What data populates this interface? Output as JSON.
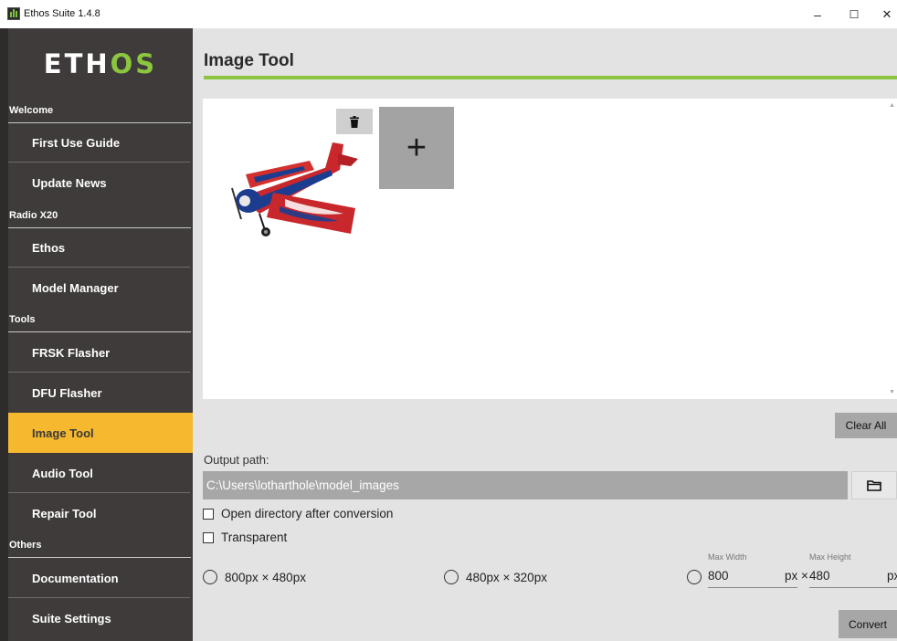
{
  "window": {
    "title": "Ethos Suite 1.4.8",
    "icon": "ethos-app-icon",
    "controls": {
      "minimize": "–",
      "maximize": "☐",
      "close": "✕"
    }
  },
  "sidebar": {
    "logo": {
      "part1": "ETH",
      "part2": "OS"
    },
    "sections": [
      {
        "label": "Welcome",
        "items": [
          "First Use Guide",
          "Update News"
        ]
      },
      {
        "label": "Radio X20",
        "items": [
          "Ethos",
          "Model Manager"
        ]
      },
      {
        "label": "Tools",
        "items": [
          "FRSK Flasher",
          "DFU Flasher",
          "Image Tool",
          "Audio Tool",
          "Repair Tool"
        ]
      },
      {
        "label": "Others",
        "items": [
          "Documentation",
          "Suite Settings"
        ]
      }
    ],
    "active_item": "Image Tool"
  },
  "main": {
    "title": "Image Tool",
    "images": {
      "thumbnail": "red-aerobatic-airplane-image",
      "delete_icon": "trash-icon",
      "add_label": "+"
    },
    "clear_all_label": "Clear All",
    "output_label": "Output path:",
    "output_path": "C:\\Users\\lotharthole\\model_images",
    "folder_icon": "folder-icon",
    "open_dir_label": "Open directory after conversion",
    "transparent_label": "Transparent",
    "size_options": {
      "option1": "800px × 480px",
      "option2": "480px × 320px",
      "custom": {
        "max_width_label": "Max Width",
        "max_height_label": "Max Height",
        "width_value": "800",
        "height_value": "480",
        "times_label": "px ×",
        "unit_label": "px"
      }
    },
    "convert_label": "Convert"
  },
  "colors": {
    "accent_green": "#8cc63f",
    "active_orange": "#f5b82e",
    "sidebar_bg": "#3e3b3a",
    "main_bg": "#e3e3e3"
  }
}
